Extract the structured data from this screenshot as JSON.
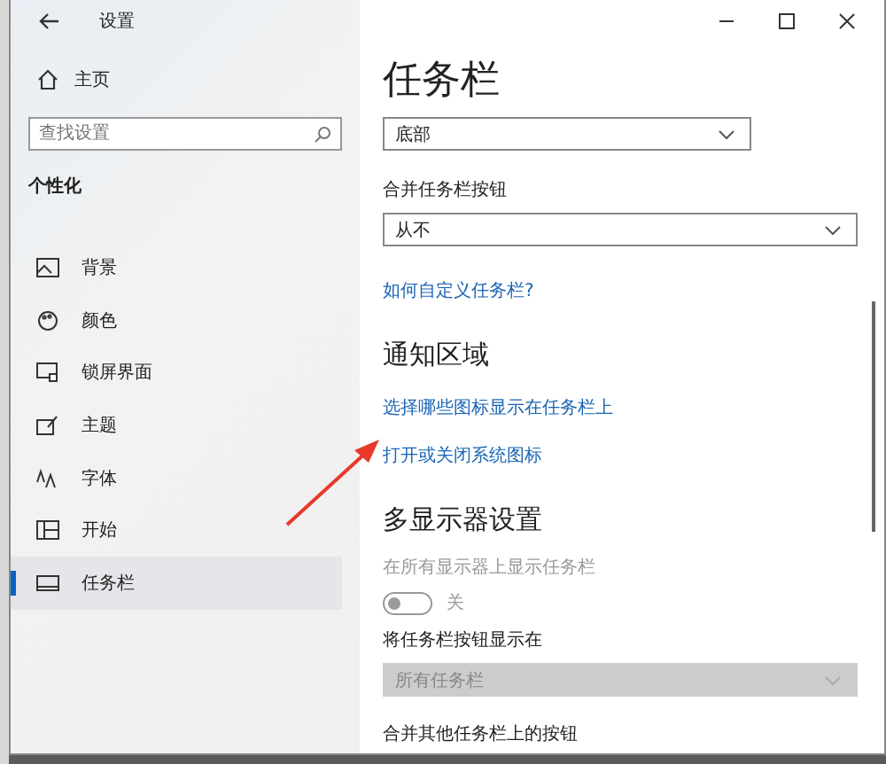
{
  "window": {
    "title": "设置"
  },
  "sidebar": {
    "home": "主页",
    "search": {
      "placeholder": "查找设置"
    },
    "section": "个性化",
    "items": [
      {
        "label": "背景",
        "selected": false
      },
      {
        "label": "颜色",
        "selected": false
      },
      {
        "label": "锁屏界面",
        "selected": false
      },
      {
        "label": "主题",
        "selected": false
      },
      {
        "label": "字体",
        "selected": false
      },
      {
        "label": "开始",
        "selected": false
      },
      {
        "label": "任务栏",
        "selected": true
      }
    ]
  },
  "content": {
    "title": "任务栏",
    "blocks": [
      {
        "kind": "dropdown",
        "value": "底部",
        "disabled": false
      },
      {
        "kind": "label",
        "text": "合并任务栏按钮",
        "disabled": false
      },
      {
        "kind": "dropdown",
        "value": "从不",
        "disabled": false
      },
      {
        "kind": "link",
        "text": "如何自定义任务栏?"
      },
      {
        "kind": "heading",
        "text": "通知区域"
      },
      {
        "kind": "link",
        "text": "选择哪些图标显示在任务栏上"
      },
      {
        "kind": "link",
        "text": "打开或关闭系统图标"
      },
      {
        "kind": "heading",
        "text": "多显示器设置"
      },
      {
        "kind": "label",
        "text": "在所有显示器上显示任务栏",
        "disabled": true
      },
      {
        "kind": "toggle",
        "on": false,
        "disabled": true,
        "text": "关"
      },
      {
        "kind": "label",
        "text": "将任务栏按钮显示在",
        "disabled": false
      },
      {
        "kind": "dropdown",
        "value": "所有任务栏",
        "disabled": true
      },
      {
        "kind": "label",
        "text": "合并其他任务栏上的按钮"
      }
    ]
  }
}
